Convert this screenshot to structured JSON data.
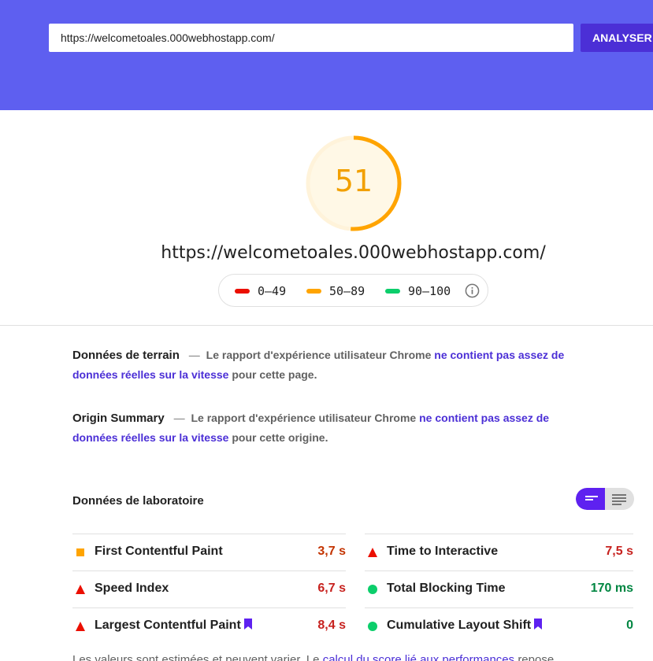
{
  "search": {
    "url_value": "https://welcometoales.000webhostapp.com/",
    "analyze_label": "ANALYSER"
  },
  "score": {
    "value": "51",
    "fraction": 0.51,
    "color": "#f2a000",
    "tested_url": "https://welcometoales.000webhostapp.com/"
  },
  "legend": {
    "items": [
      {
        "label": "0–49",
        "color": "#eb0f00"
      },
      {
        "label": "50–89",
        "color": "#ffa400"
      },
      {
        "label": "90–100",
        "color": "#0cce6b"
      }
    ],
    "info_icon": "info-icon"
  },
  "field_data": {
    "title": "Données de terrain",
    "dash": "—",
    "desc_before": "Le rapport d'expérience utilisateur Chrome",
    "link": "ne contient pas assez de données réelles sur la vitesse",
    "desc_after": "pour cette page."
  },
  "origin_summary": {
    "title": "Origin Summary",
    "dash": "—",
    "desc_before": "Le rapport d'expérience utilisateur Chrome",
    "link": "ne contient pas assez de données réelles sur la vitesse",
    "desc_after": "pour cette origine."
  },
  "lab_data": {
    "title": "Données de laboratoire",
    "toggle": {
      "left_icon": "compact-view-icon",
      "right_icon": "detailed-view-icon",
      "active": "left"
    },
    "metrics": [
      {
        "name": "First Contentful Paint",
        "value": "3,7 s",
        "status": "average",
        "icon": "square-icon",
        "color": "#ffa400",
        "value_color": "#c33300",
        "bookmark": false
      },
      {
        "name": "Time to Interactive",
        "value": "7,5 s",
        "status": "fail",
        "icon": "triangle-icon",
        "color": "#eb0f00",
        "value_color": "#c7221f",
        "bookmark": false
      },
      {
        "name": "Speed Index",
        "value": "6,7 s",
        "status": "fail",
        "icon": "triangle-icon",
        "color": "#eb0f00",
        "value_color": "#c7221f",
        "bookmark": false
      },
      {
        "name": "Total Blocking Time",
        "value": "170 ms",
        "status": "pass",
        "icon": "circle-icon",
        "color": "#0cce6b",
        "value_color": "#018642",
        "bookmark": false
      },
      {
        "name": "Largest Contentful Paint",
        "value": "8,4 s",
        "status": "fail",
        "icon": "triangle-icon",
        "color": "#eb0f00",
        "value_color": "#c7221f",
        "bookmark": true
      },
      {
        "name": "Cumulative Layout Shift",
        "value": "0",
        "status": "pass",
        "icon": "circle-icon",
        "color": "#0cce6b",
        "value_color": "#018642",
        "bookmark": true
      }
    ]
  },
  "footer": {
    "text_before": "Les valeurs sont estimées et peuvent varier. Le",
    "link": "calcul du score lié aux performances",
    "text_after": "repose"
  },
  "colors": {
    "header_bg": "#5e5ff0",
    "button_bg": "#4b2fd6",
    "link": "#4b2fd6",
    "toggle_active": "#5e21f0"
  }
}
